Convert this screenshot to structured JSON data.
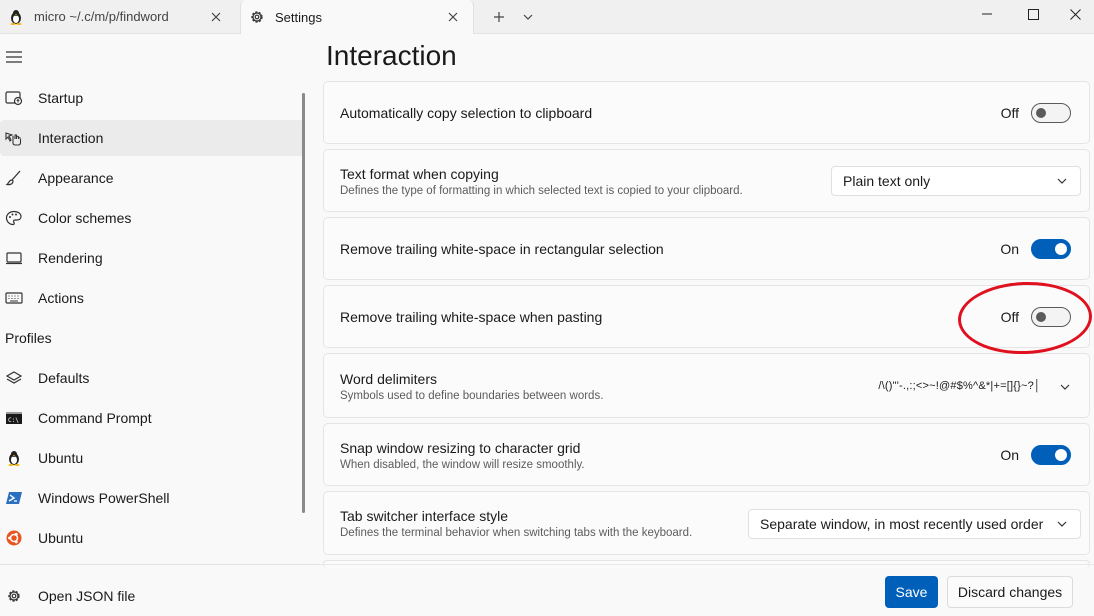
{
  "tabs": [
    {
      "label": "micro ~/.c/m/p/findword",
      "icon": "linux-penguin-icon"
    },
    {
      "label": "Settings",
      "icon": "gear-icon"
    }
  ],
  "sidebar": {
    "items": [
      {
        "label": "Startup",
        "icon": "startup-icon"
      },
      {
        "label": "Interaction",
        "icon": "interaction-icon",
        "selected": true
      },
      {
        "label": "Appearance",
        "icon": "brush-icon"
      },
      {
        "label": "Color schemes",
        "icon": "palette-icon"
      },
      {
        "label": "Rendering",
        "icon": "monitor-icon"
      },
      {
        "label": "Actions",
        "icon": "keyboard-icon"
      }
    ],
    "profiles_header": "Profiles",
    "profiles": [
      {
        "label": "Defaults",
        "icon": "layers-icon"
      },
      {
        "label": "Command Prompt",
        "icon": "cmd-icon"
      },
      {
        "label": "Ubuntu",
        "icon": "linux-penguin-icon"
      },
      {
        "label": "Windows PowerShell",
        "icon": "powershell-icon"
      },
      {
        "label": "Ubuntu",
        "icon": "ubuntu-icon"
      }
    ],
    "open_json": "Open JSON file"
  },
  "page": {
    "title": "Interaction",
    "settings": {
      "auto_copy": {
        "label": "Automatically copy selection to clipboard",
        "state": "Off"
      },
      "text_format": {
        "label": "Text format when copying",
        "desc": "Defines the type of formatting in which selected text is copied to your clipboard.",
        "value": "Plain text only"
      },
      "trim_block": {
        "label": "Remove trailing white-space in rectangular selection",
        "state": "On"
      },
      "trim_paste": {
        "label": "Remove trailing white-space when pasting",
        "state": "Off"
      },
      "word_delims": {
        "label": "Word delimiters",
        "desc": "Symbols used to define boundaries between words.",
        "value": "/\\()\"'-.,:;<>~!@#$%^&*|+=[]{}~?│"
      },
      "snap_resize": {
        "label": "Snap window resizing to character grid",
        "desc": "When disabled, the window will resize smoothly.",
        "state": "On"
      },
      "tab_switcher": {
        "label": "Tab switcher interface style",
        "desc": "Defines the terminal behavior when switching tabs with the keyboard.",
        "value": "Separate window, in most recently used order"
      }
    }
  },
  "footer": {
    "save": "Save",
    "discard": "Discard changes"
  },
  "colors": {
    "accent": "#005fb8",
    "annotation": "#e0101e"
  }
}
